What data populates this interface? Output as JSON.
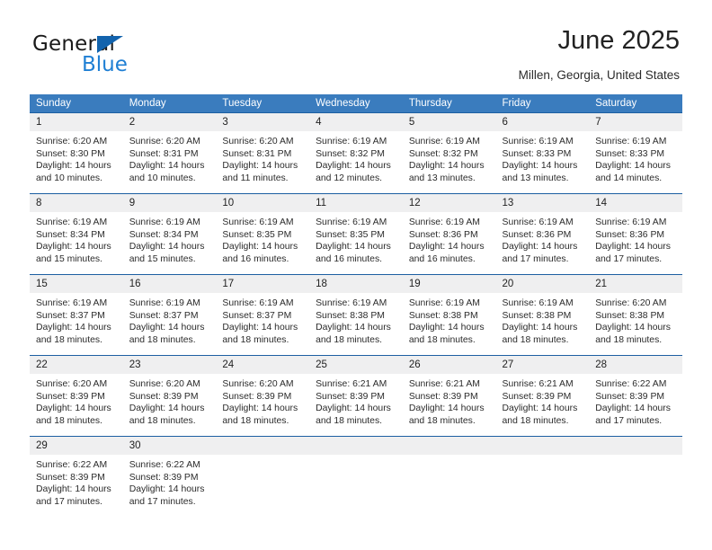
{
  "brand": {
    "name_part1": "General",
    "name_part2": "Blue",
    "triangle_color": "#1263ad",
    "blue_color": "#1f7fd4"
  },
  "header": {
    "title": "June 2025",
    "subtitle": "Millen, Georgia, United States",
    "header_bg": "#3a7cbe",
    "row_divider": "#1d5fa2",
    "daynum_bg": "#efeff0"
  },
  "weekdays": [
    "Sunday",
    "Monday",
    "Tuesday",
    "Wednesday",
    "Thursday",
    "Friday",
    "Saturday"
  ],
  "labels": {
    "sunrise": "Sunrise:",
    "sunset": "Sunset:",
    "daylight": "Daylight:"
  },
  "weeks": [
    [
      {
        "day": "1",
        "sunrise": "Sunrise: 6:20 AM",
        "sunset": "Sunset: 8:30 PM",
        "daylight1": "Daylight: 14 hours",
        "daylight2": "and 10 minutes."
      },
      {
        "day": "2",
        "sunrise": "Sunrise: 6:20 AM",
        "sunset": "Sunset: 8:31 PM",
        "daylight1": "Daylight: 14 hours",
        "daylight2": "and 10 minutes."
      },
      {
        "day": "3",
        "sunrise": "Sunrise: 6:20 AM",
        "sunset": "Sunset: 8:31 PM",
        "daylight1": "Daylight: 14 hours",
        "daylight2": "and 11 minutes."
      },
      {
        "day": "4",
        "sunrise": "Sunrise: 6:19 AM",
        "sunset": "Sunset: 8:32 PM",
        "daylight1": "Daylight: 14 hours",
        "daylight2": "and 12 minutes."
      },
      {
        "day": "5",
        "sunrise": "Sunrise: 6:19 AM",
        "sunset": "Sunset: 8:32 PM",
        "daylight1": "Daylight: 14 hours",
        "daylight2": "and 13 minutes."
      },
      {
        "day": "6",
        "sunrise": "Sunrise: 6:19 AM",
        "sunset": "Sunset: 8:33 PM",
        "daylight1": "Daylight: 14 hours",
        "daylight2": "and 13 minutes."
      },
      {
        "day": "7",
        "sunrise": "Sunrise: 6:19 AM",
        "sunset": "Sunset: 8:33 PM",
        "daylight1": "Daylight: 14 hours",
        "daylight2": "and 14 minutes."
      }
    ],
    [
      {
        "day": "8",
        "sunrise": "Sunrise: 6:19 AM",
        "sunset": "Sunset: 8:34 PM",
        "daylight1": "Daylight: 14 hours",
        "daylight2": "and 15 minutes."
      },
      {
        "day": "9",
        "sunrise": "Sunrise: 6:19 AM",
        "sunset": "Sunset: 8:34 PM",
        "daylight1": "Daylight: 14 hours",
        "daylight2": "and 15 minutes."
      },
      {
        "day": "10",
        "sunrise": "Sunrise: 6:19 AM",
        "sunset": "Sunset: 8:35 PM",
        "daylight1": "Daylight: 14 hours",
        "daylight2": "and 16 minutes."
      },
      {
        "day": "11",
        "sunrise": "Sunrise: 6:19 AM",
        "sunset": "Sunset: 8:35 PM",
        "daylight1": "Daylight: 14 hours",
        "daylight2": "and 16 minutes."
      },
      {
        "day": "12",
        "sunrise": "Sunrise: 6:19 AM",
        "sunset": "Sunset: 8:36 PM",
        "daylight1": "Daylight: 14 hours",
        "daylight2": "and 16 minutes."
      },
      {
        "day": "13",
        "sunrise": "Sunrise: 6:19 AM",
        "sunset": "Sunset: 8:36 PM",
        "daylight1": "Daylight: 14 hours",
        "daylight2": "and 17 minutes."
      },
      {
        "day": "14",
        "sunrise": "Sunrise: 6:19 AM",
        "sunset": "Sunset: 8:36 PM",
        "daylight1": "Daylight: 14 hours",
        "daylight2": "and 17 minutes."
      }
    ],
    [
      {
        "day": "15",
        "sunrise": "Sunrise: 6:19 AM",
        "sunset": "Sunset: 8:37 PM",
        "daylight1": "Daylight: 14 hours",
        "daylight2": "and 18 minutes."
      },
      {
        "day": "16",
        "sunrise": "Sunrise: 6:19 AM",
        "sunset": "Sunset: 8:37 PM",
        "daylight1": "Daylight: 14 hours",
        "daylight2": "and 18 minutes."
      },
      {
        "day": "17",
        "sunrise": "Sunrise: 6:19 AM",
        "sunset": "Sunset: 8:37 PM",
        "daylight1": "Daylight: 14 hours",
        "daylight2": "and 18 minutes."
      },
      {
        "day": "18",
        "sunrise": "Sunrise: 6:19 AM",
        "sunset": "Sunset: 8:38 PM",
        "daylight1": "Daylight: 14 hours",
        "daylight2": "and 18 minutes."
      },
      {
        "day": "19",
        "sunrise": "Sunrise: 6:19 AM",
        "sunset": "Sunset: 8:38 PM",
        "daylight1": "Daylight: 14 hours",
        "daylight2": "and 18 minutes."
      },
      {
        "day": "20",
        "sunrise": "Sunrise: 6:19 AM",
        "sunset": "Sunset: 8:38 PM",
        "daylight1": "Daylight: 14 hours",
        "daylight2": "and 18 minutes."
      },
      {
        "day": "21",
        "sunrise": "Sunrise: 6:20 AM",
        "sunset": "Sunset: 8:38 PM",
        "daylight1": "Daylight: 14 hours",
        "daylight2": "and 18 minutes."
      }
    ],
    [
      {
        "day": "22",
        "sunrise": "Sunrise: 6:20 AM",
        "sunset": "Sunset: 8:39 PM",
        "daylight1": "Daylight: 14 hours",
        "daylight2": "and 18 minutes."
      },
      {
        "day": "23",
        "sunrise": "Sunrise: 6:20 AM",
        "sunset": "Sunset: 8:39 PM",
        "daylight1": "Daylight: 14 hours",
        "daylight2": "and 18 minutes."
      },
      {
        "day": "24",
        "sunrise": "Sunrise: 6:20 AM",
        "sunset": "Sunset: 8:39 PM",
        "daylight1": "Daylight: 14 hours",
        "daylight2": "and 18 minutes."
      },
      {
        "day": "25",
        "sunrise": "Sunrise: 6:21 AM",
        "sunset": "Sunset: 8:39 PM",
        "daylight1": "Daylight: 14 hours",
        "daylight2": "and 18 minutes."
      },
      {
        "day": "26",
        "sunrise": "Sunrise: 6:21 AM",
        "sunset": "Sunset: 8:39 PM",
        "daylight1": "Daylight: 14 hours",
        "daylight2": "and 18 minutes."
      },
      {
        "day": "27",
        "sunrise": "Sunrise: 6:21 AM",
        "sunset": "Sunset: 8:39 PM",
        "daylight1": "Daylight: 14 hours",
        "daylight2": "and 18 minutes."
      },
      {
        "day": "28",
        "sunrise": "Sunrise: 6:22 AM",
        "sunset": "Sunset: 8:39 PM",
        "daylight1": "Daylight: 14 hours",
        "daylight2": "and 17 minutes."
      }
    ],
    [
      {
        "day": "29",
        "sunrise": "Sunrise: 6:22 AM",
        "sunset": "Sunset: 8:39 PM",
        "daylight1": "Daylight: 14 hours",
        "daylight2": "and 17 minutes."
      },
      {
        "day": "30",
        "sunrise": "Sunrise: 6:22 AM",
        "sunset": "Sunset: 8:39 PM",
        "daylight1": "Daylight: 14 hours",
        "daylight2": "and 17 minutes."
      },
      {
        "day": "",
        "sunrise": "",
        "sunset": "",
        "daylight1": "",
        "daylight2": ""
      },
      {
        "day": "",
        "sunrise": "",
        "sunset": "",
        "daylight1": "",
        "daylight2": ""
      },
      {
        "day": "",
        "sunrise": "",
        "sunset": "",
        "daylight1": "",
        "daylight2": ""
      },
      {
        "day": "",
        "sunrise": "",
        "sunset": "",
        "daylight1": "",
        "daylight2": ""
      },
      {
        "day": "",
        "sunrise": "",
        "sunset": "",
        "daylight1": "",
        "daylight2": ""
      }
    ]
  ]
}
